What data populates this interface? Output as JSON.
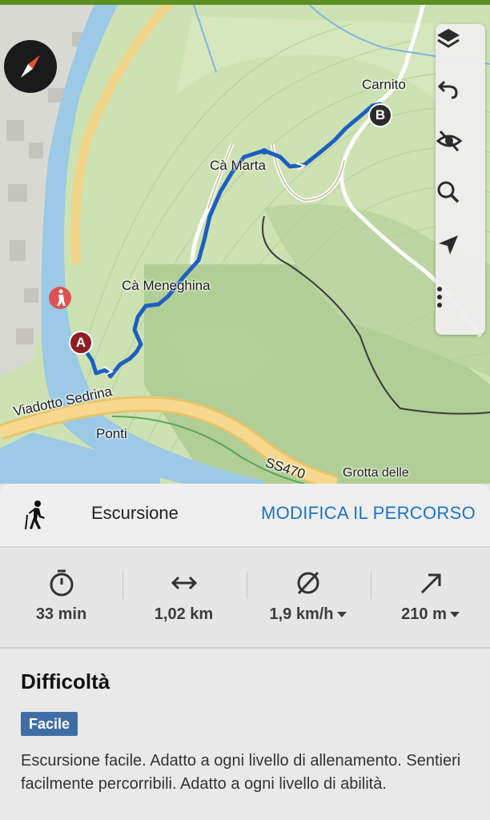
{
  "map": {
    "labels": {
      "carnito": "Carnito",
      "ca_marta": "Cà Marta",
      "ca_meneghina": "Cà Meneghina",
      "viadotto": "Viadotto Sedrina",
      "ponti": "Ponti",
      "ss470": "SS470",
      "grotta": "Grotta delle"
    },
    "markers": {
      "start": "A",
      "end": "B"
    },
    "icons": {
      "compass": "compass-icon",
      "hiker_poi": "hiker-poi-icon",
      "layers": "layers-icon",
      "undo": "undo-icon",
      "hide": "eye-off-icon",
      "search": "search-icon",
      "locate": "navigation-arrow-icon",
      "more": "more-vertical-icon"
    },
    "colors": {
      "route": "#1d5fc0",
      "start_marker": "#8e1f24",
      "end_marker": "#2b2b2b",
      "road": "#f3cd6c"
    }
  },
  "panel": {
    "activity": {
      "icon": "hiking-icon",
      "label": "Escursione"
    },
    "edit_route": "MODIFICA IL PERCORSO",
    "stats": {
      "duration": {
        "icon": "stopwatch-icon",
        "value": "33  min"
      },
      "distance": {
        "icon": "horizontal-arrows-icon",
        "value": "1,02 km"
      },
      "speed": {
        "icon": "average-speed-icon",
        "value": "1,9 km/h"
      },
      "ascent": {
        "icon": "ascent-arrow-icon",
        "value": "210 m"
      }
    },
    "difficulty": {
      "title": "Difficoltà",
      "badge": "Facile",
      "badge_color": "#3f6ea7",
      "description": "Escursione facile. Adatto a ogni livello di allenamento. Sentieri facilmente percorribili. Adatto a ogni livello di abilità."
    },
    "accent_color": "#1a73c9"
  }
}
